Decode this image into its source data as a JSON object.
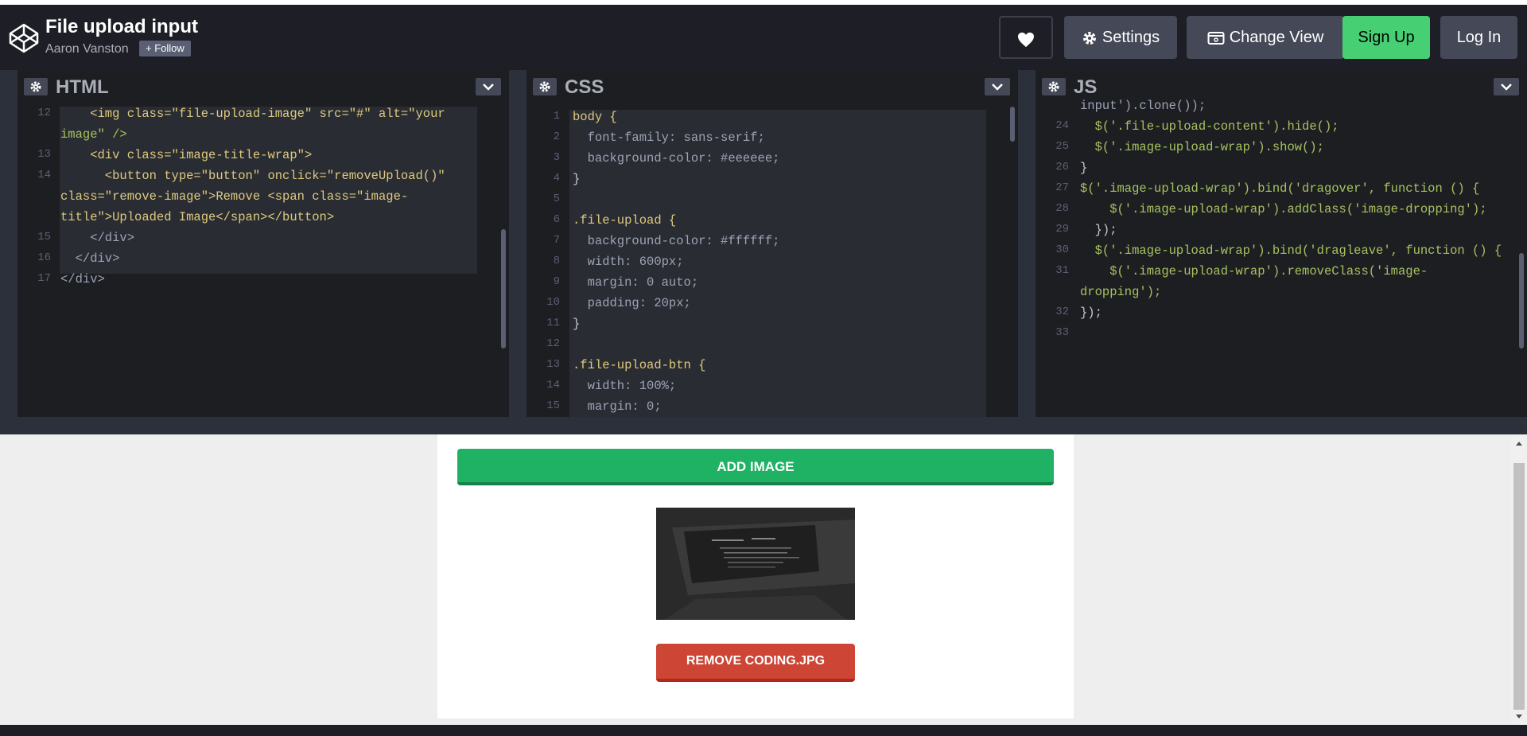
{
  "header": {
    "title": "File upload input",
    "author": "Aaron Vanston",
    "follow_label": "+ Follow",
    "settings_label": "Settings",
    "change_view_label": "Change View",
    "signup_label": "Sign Up",
    "login_label": "Log In"
  },
  "panes": {
    "html": {
      "title": "HTML",
      "lines": [
        {
          "n": "12",
          "text": "    <img class=\"file-upload-image\" src=\"#\" alt=\"your"
        },
        {
          "n": "",
          "text": "image\" />"
        },
        {
          "n": "13",
          "text": "    <div class=\"image-title-wrap\">"
        },
        {
          "n": "14",
          "text": "      <button type=\"button\" onclick=\"removeUpload()\""
        },
        {
          "n": "",
          "text": "class=\"remove-image\">Remove <span class=\"image-"
        },
        {
          "n": "",
          "text": "title\">Uploaded Image</span></button>"
        },
        {
          "n": "15",
          "text": "    </div>"
        },
        {
          "n": "16",
          "text": "  </div>"
        },
        {
          "n": "17",
          "text": "</div>"
        }
      ]
    },
    "css": {
      "title": "CSS",
      "lines": [
        {
          "n": "1",
          "text": "body {"
        },
        {
          "n": "2",
          "text": "  font-family: sans-serif;"
        },
        {
          "n": "3",
          "text": "  background-color: #eeeeee;"
        },
        {
          "n": "4",
          "text": "}"
        },
        {
          "n": "5",
          "text": ""
        },
        {
          "n": "6",
          "text": ".file-upload {"
        },
        {
          "n": "7",
          "text": "  background-color: #ffffff;"
        },
        {
          "n": "8",
          "text": "  width: 600px;"
        },
        {
          "n": "9",
          "text": "  margin: 0 auto;"
        },
        {
          "n": "10",
          "text": "  padding: 20px;"
        },
        {
          "n": "11",
          "text": "}"
        },
        {
          "n": "12",
          "text": ""
        },
        {
          "n": "13",
          "text": ".file-upload-btn {"
        },
        {
          "n": "14",
          "text": "  width: 100%;"
        },
        {
          "n": "15",
          "text": "  margin: 0;"
        }
      ]
    },
    "js": {
      "title": "JS",
      "lines": [
        {
          "n": "",
          "text": "input').clone());"
        },
        {
          "n": "24",
          "text": "  $('.file-upload-content').hide();"
        },
        {
          "n": "25",
          "text": "  $('.image-upload-wrap').show();"
        },
        {
          "n": "26",
          "text": "}"
        },
        {
          "n": "27",
          "text": "$('.image-upload-wrap').bind('dragover', function () {"
        },
        {
          "n": "28",
          "text": "    $('.image-upload-wrap').addClass('image-dropping');"
        },
        {
          "n": "29",
          "text": "  });"
        },
        {
          "n": "30",
          "text": "  $('.image-upload-wrap').bind('dragleave', function () {"
        },
        {
          "n": "31",
          "text": "    $('.image-upload-wrap').removeClass('image-"
        },
        {
          "n": "",
          "text": "dropping');"
        },
        {
          "n": "32",
          "text": "});"
        },
        {
          "n": "33",
          "text": ""
        }
      ]
    }
  },
  "preview": {
    "add_image_label": "ADD IMAGE",
    "remove_label": "REMOVE CODING.JPG"
  },
  "colors": {
    "signup": "#47cf73",
    "add_button": "#1fb264",
    "remove_button": "#cd4535"
  }
}
